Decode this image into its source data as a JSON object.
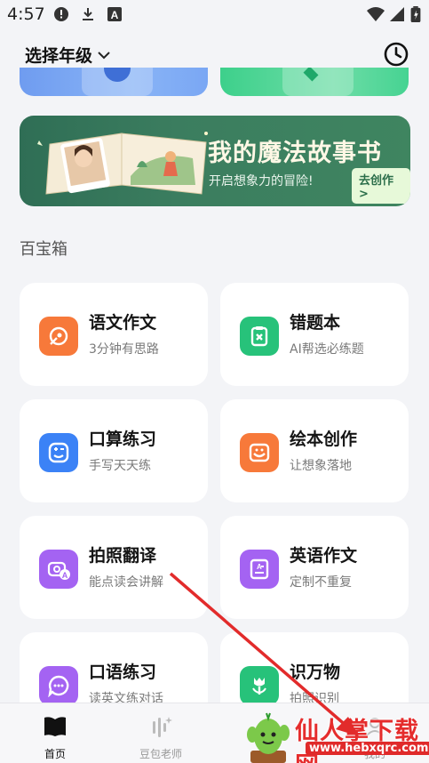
{
  "status_bar": {
    "time": "4:57",
    "icons": [
      "alert-icon",
      "download-icon",
      "font-icon",
      "wifi-icon",
      "signal-icon",
      "battery-icon"
    ]
  },
  "header": {
    "grade_select_label": "选择年级",
    "history_icon": "clock-icon"
  },
  "banner": {
    "title": "我的魔法故事书",
    "subtitle": "开启想象力的冒险!",
    "cta": "去创作 >"
  },
  "toolbox": {
    "title": "百宝箱",
    "tools": [
      {
        "name": "语文作文",
        "desc": "3分钟有思路",
        "icon": "pen-nib-icon",
        "color": "#f7793a"
      },
      {
        "name": "错题本",
        "desc": "AI帮选必练题",
        "icon": "clipboard-x-icon",
        "color": "#27c27a"
      },
      {
        "name": "口算练习",
        "desc": "手写天天练",
        "icon": "calculator-face-icon",
        "color": "#3b82f6"
      },
      {
        "name": "绘本创作",
        "desc": "让想象落地",
        "icon": "picture-book-icon",
        "color": "#f7793a"
      },
      {
        "name": "拍照翻译",
        "desc": "能点读会讲解",
        "icon": "camera-translate-icon",
        "color": "#a463f2"
      },
      {
        "name": "英语作文",
        "desc": "定制不重复",
        "icon": "document-a-icon",
        "color": "#a463f2"
      },
      {
        "name": "口语练习",
        "desc": "读英文练对话",
        "icon": "speech-bubble-icon",
        "color": "#a463f2"
      },
      {
        "name": "识万物",
        "desc": "拍照识别",
        "icon": "tulip-icon",
        "color": "#27c27a"
      }
    ]
  },
  "bottom_nav": {
    "items": [
      {
        "label": "首页",
        "icon": "book-icon",
        "active": true
      },
      {
        "label": "豆包老师",
        "icon": "sound-bars-icon",
        "active": false
      },
      {
        "label": "我的",
        "icon": "profile-icon",
        "active": false
      }
    ]
  },
  "watermark": {
    "text": "仙人掌下载网",
    "url": "www.hebxqrc.com"
  },
  "colors": {
    "accent_red": "#e02a2a",
    "banner_green": "#3b7d5f"
  }
}
